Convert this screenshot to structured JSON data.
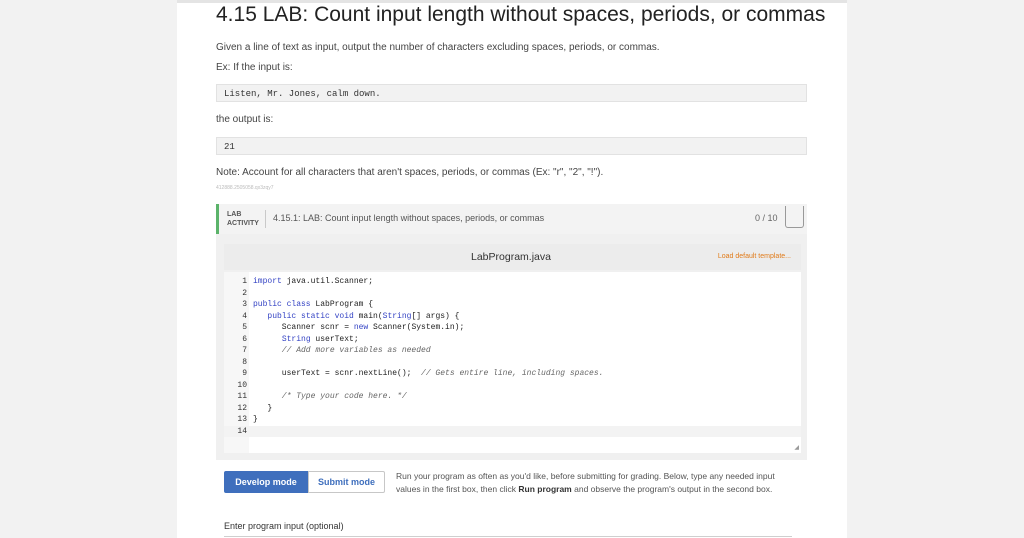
{
  "section": {
    "title": "4.15 LAB: Count input length without spaces, periods, or commas",
    "description": "Given a line of text as input, output the number of characters excluding spaces, periods, or commas.",
    "example_label": "Ex: If the input is:",
    "example_input": "Listen, Mr. Jones, calm down.",
    "output_label": "the output is:",
    "example_output": "21",
    "note": "Note: Account for all characters that aren't spaces, periods, or commas (Ex: \"r\", \"2\", \"!\").",
    "tiny_id": "412888.2505058.qx3zqy7"
  },
  "lab": {
    "badge_line1": "LAB",
    "badge_line2": "ACTIVITY",
    "title": "4.15.1: LAB: Count input length without spaces, periods, or commas",
    "score": "0 / 10"
  },
  "editor": {
    "file_name": "LabProgram.java",
    "load_template": "Load default template...",
    "line_numbers": [
      "1",
      "2",
      "3",
      "4",
      "5",
      "6",
      "7",
      "8",
      "9",
      "10",
      "11",
      "12",
      "13",
      "14"
    ],
    "code": {
      "l1_kw": "import",
      "l1_rest": " java.util.Scanner;",
      "l3_kw": "public class",
      "l3_rest": " LabProgram {",
      "l4_indent": "   ",
      "l4_kw": "public static void",
      "l4_mid": " main(",
      "l4_type": "String",
      "l4_rest": "[] args) {",
      "l5_a": "      Scanner scnr = ",
      "l5_kw": "new",
      "l5_b": " Scanner(System.in);",
      "l6_indent": "      ",
      "l6_type": "String",
      "l6_rest": " userText;",
      "l7_comment": "      // Add more variables as needed",
      "l9_code": "      userText = scnr.nextLine();  ",
      "l9_comment": "// Gets entire line, including spaces.",
      "l11_comment": "      /* Type your code here. */",
      "l12": "   }",
      "l13": "}"
    }
  },
  "modes": {
    "develop": "Develop mode",
    "submit": "Submit mode",
    "help_1": "Run your program as often as you'd like, before submitting for grading. Below, type any needed input values in the first box, then click ",
    "help_bold": "Run program",
    "help_2": " and observe the program's output in the second box."
  },
  "input": {
    "label": "Enter program input (optional)"
  }
}
